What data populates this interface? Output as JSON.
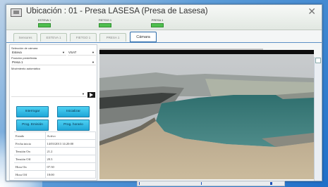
{
  "window": {
    "title": "Ubicación : 01 - Presa LASESA (Presa de Lasesa)",
    "close_icon": "close-icon"
  },
  "stations": [
    {
      "label": "ESTEVA 1",
      "status_color": "#4fbf4f"
    },
    {
      "label": "FIETGO 1",
      "status_color": "#4fbf4f"
    },
    {
      "label": "PRESA 1",
      "status_color": "#4fbf4f"
    }
  ],
  "tabs": [
    {
      "label": "Sensores",
      "active": false
    },
    {
      "label": "ESTEVA 1",
      "active": false
    },
    {
      "label": "FIETGO 1",
      "active": false
    },
    {
      "label": "PRESA 1",
      "active": false
    },
    {
      "label": "Cámara",
      "active": true
    }
  ],
  "left_panel": {
    "camera_label": "Selección de cámara",
    "camera_value": "Esteva",
    "vsat_value": "VSAT",
    "position_label": "Posición predefinida",
    "position_value": "Presa 1",
    "movement_label": "Movimiento automático",
    "movement_value": "",
    "buttons": {
      "interrogar": "Interrogar",
      "inicializar": "Inicializar",
      "prog_emision": "Prog. Emisión",
      "prog_horario": "Prog. horario"
    },
    "status": [
      {
        "key": "Estado",
        "value": "Activo"
      },
      {
        "key": "Fecha inicio",
        "value": "14/03/2013 14:20:00"
      },
      {
        "key": "Tensión On",
        "value": "21.2"
      },
      {
        "key": "Tensión Off",
        "value": "20.3"
      },
      {
        "key": "Hora On",
        "value": "07:30"
      },
      {
        "key": "Hora Off",
        "value": "18:00"
      }
    ]
  },
  "colors": {
    "button": "#2bb8e6",
    "tab_active_border": "#2b6aa8",
    "status_led": "#4fbf4f",
    "timeline_seg": "#1f4fb7"
  }
}
